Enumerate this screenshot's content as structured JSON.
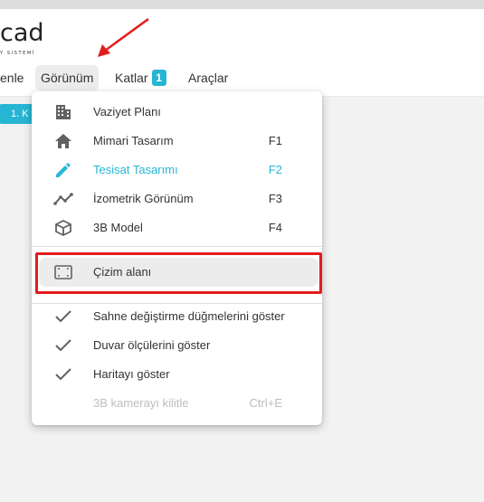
{
  "header": {
    "logo_text": "cad",
    "logo_sub": "Y SISTEMİ"
  },
  "menubar": {
    "items": [
      {
        "label": "enle"
      },
      {
        "label": "Görünüm"
      },
      {
        "label": "Katlar",
        "badge": "1"
      },
      {
        "label": "Araçlar"
      }
    ]
  },
  "floor_pill": "1. K",
  "dropdown": {
    "items": [
      {
        "label": "Vaziyet Planı",
        "key": "",
        "icon": "building-icon"
      },
      {
        "label": "Mimari Tasarım",
        "key": "F1",
        "icon": "home-icon"
      },
      {
        "label": "Tesisat Tasarımı",
        "key": "F2",
        "icon": "pencil-icon",
        "active": true
      },
      {
        "label": "İzometrik Görünüm",
        "key": "F3",
        "icon": "isometric-line-icon"
      },
      {
        "label": "3B Model",
        "key": "F4",
        "icon": "cube-icon"
      },
      {
        "label": "Çizim alanı",
        "key": "",
        "icon": "drawing-area-icon",
        "highlighted": true
      },
      {
        "label": "Sahne değiştirme düğmelerini göster",
        "key": "",
        "icon": "check-icon"
      },
      {
        "label": "Duvar ölçülerini göster",
        "key": "",
        "icon": "check-icon"
      },
      {
        "label": "Haritayı göster",
        "key": "",
        "icon": "check-icon"
      },
      {
        "label": "3B kamerayı kilitle",
        "key": "Ctrl+E",
        "icon": "",
        "disabled": true
      }
    ]
  },
  "colors": {
    "accent": "#26b6d4",
    "annotation_red": "#e21c1c",
    "icon_gray": "#616161"
  }
}
